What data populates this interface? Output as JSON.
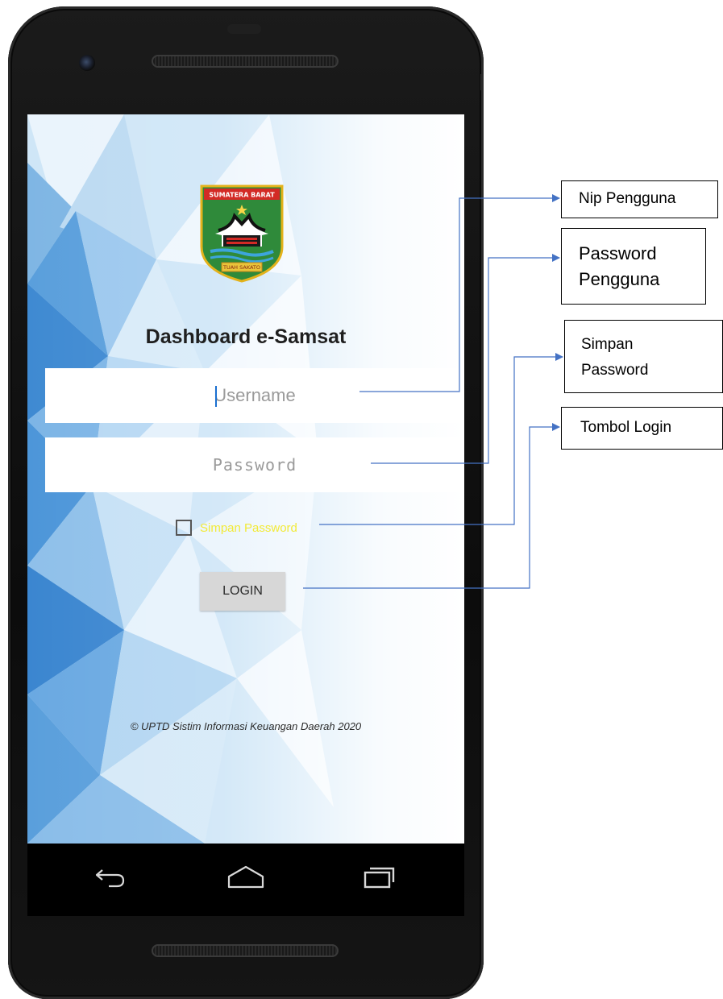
{
  "app": {
    "title": "Dashboard e-Samsat",
    "logo_top_text": "SUMATERA BARAT",
    "logo_bottom_text": "TUAH SAKATO"
  },
  "login_form": {
    "username_placeholder": "Username",
    "password_placeholder": "Password",
    "remember_label": "Simpan Password",
    "login_button": "LOGIN"
  },
  "footer": {
    "text": "© UPTD Sistim Informasi Keuangan Daerah 2020"
  },
  "navigation": {
    "back_icon": "back-arrow-icon",
    "home_icon": "home-icon",
    "recent_icon": "recent-apps-icon"
  },
  "annotations": {
    "nip": "Nip Pengguna",
    "password_line1": "Password",
    "password_line2": "Pengguna",
    "simpan_line1": "Simpan",
    "simpan_line2": "Password",
    "login": "Tombol Login"
  },
  "colors": {
    "remember_label": "#f2ea38",
    "connector": "#4472c4",
    "login_button": "#d7d7d7"
  }
}
